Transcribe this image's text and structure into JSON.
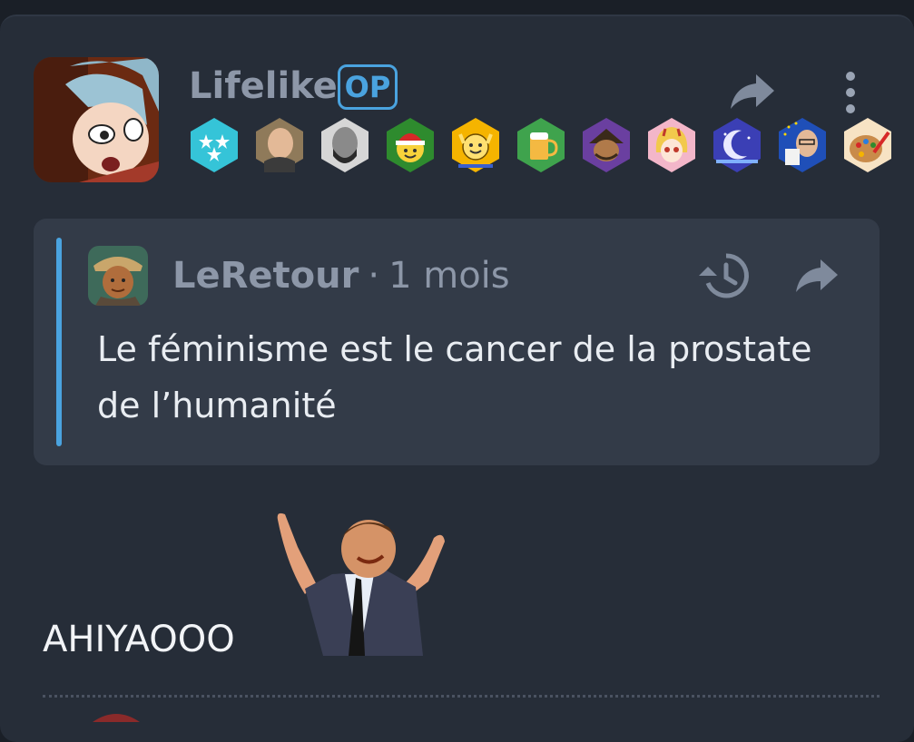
{
  "post": {
    "author": "Lifelike",
    "op_label": "OP",
    "badges": [
      "stars-badge",
      "bald-man-badge",
      "bearded-man-badge",
      "santa-smiley-badge",
      "hands-up-smiley-badge",
      "beer-badge",
      "wizard-badge",
      "anime-girl-badge",
      "moon-badge",
      "eu-man-badge",
      "palette-badge"
    ],
    "quote": {
      "author": "LeRetour",
      "separator": "·",
      "time": "1 mois",
      "text": "Le féminisme est le cancer de la prostate de l’humanité"
    },
    "body": "AHIYAOOO"
  },
  "colors": {
    "background": "#1a1f27",
    "card": "#262d38",
    "quote_bg": "#333b48",
    "accent": "#4aa3df",
    "muted_text": "#8d97a8",
    "text": "#e9edf2"
  }
}
